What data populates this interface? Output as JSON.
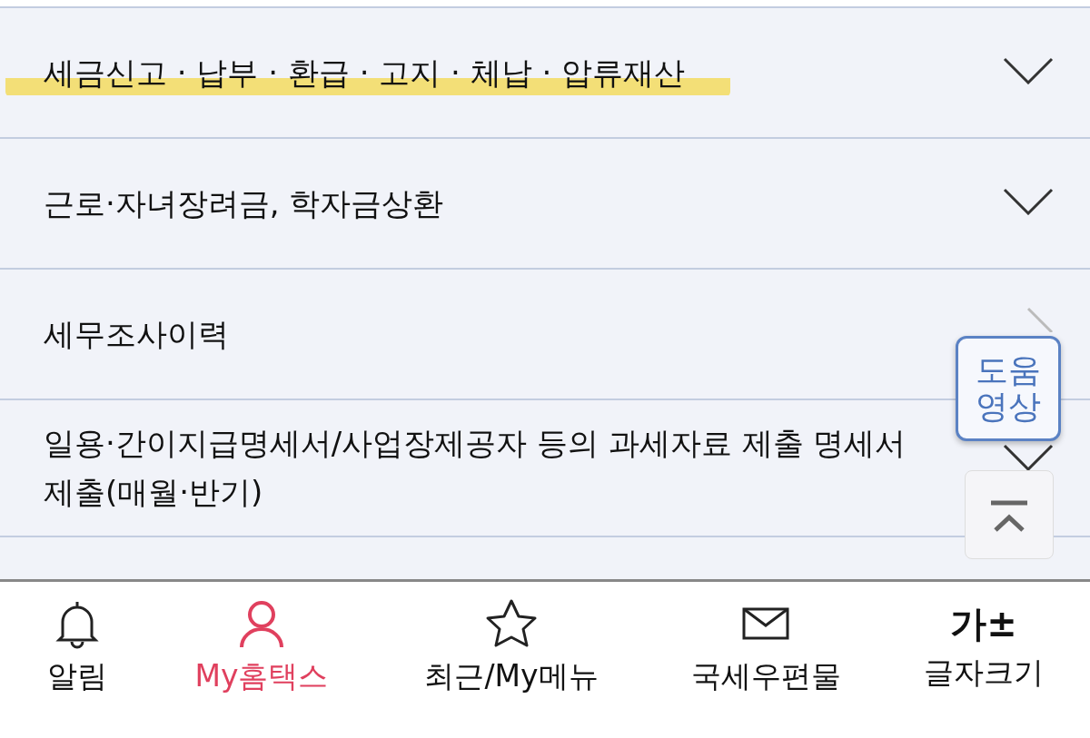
{
  "menu": [
    {
      "label": "세금신고 · 납부 · 환급 · 고지 · 체납 · 압류재산",
      "kind": "expand",
      "highlighted": true
    },
    {
      "label": "근로·자녀장려금, 학자금상환",
      "kind": "expand",
      "highlighted": false
    },
    {
      "label": "세무조사이력",
      "kind": "link",
      "highlighted": false
    },
    {
      "label": "일용·간이지급명세서/사업장제공자 등의 과세자료 제출 명세서 제출(매월·반기)",
      "kind": "expand",
      "highlighted": false
    }
  ],
  "help_video_button": {
    "label": "도움 영상"
  },
  "bottom_nav": [
    {
      "label": "알림",
      "selected": false
    },
    {
      "label": "My홈택스",
      "selected": true
    },
    {
      "label": "최근/My메뉴",
      "selected": false
    },
    {
      "label": "국세우편물",
      "selected": false
    },
    {
      "label": "글자크기",
      "icon_text": "가±",
      "selected": false
    }
  ]
}
